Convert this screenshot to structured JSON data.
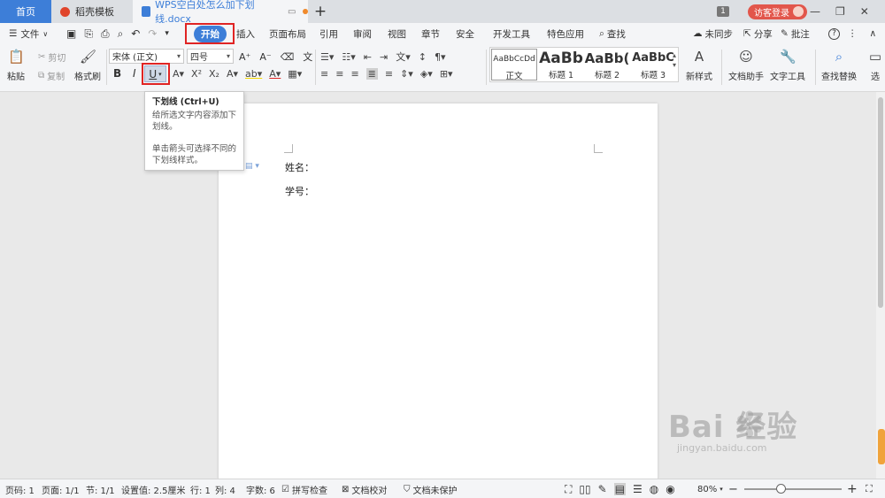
{
  "tabs": {
    "home": "首页",
    "template": "稻壳模板",
    "document": "WPS空白处怎么加下划线.docx",
    "new_tab": "+"
  },
  "titlebar": {
    "badge": "1",
    "login": "访客登录"
  },
  "menu": {
    "file": "文件",
    "items": [
      "开始",
      "插入",
      "页面布局",
      "引用",
      "审阅",
      "视图",
      "章节",
      "安全",
      "开发工具",
      "特色应用"
    ],
    "search": "查找",
    "sync": "未同步",
    "share": "分享",
    "comment": "批注",
    "help": "?"
  },
  "ribbon": {
    "paste": "粘贴",
    "cut": "剪切",
    "copy": "复制",
    "format_painter": "格式刷",
    "font_name": "宋体 (正文)",
    "font_size": "四号",
    "bold": "B",
    "italic": "I",
    "underline": "U",
    "styles": [
      {
        "preview": "AaBbCcDd",
        "label": "正文"
      },
      {
        "preview": "AaBb",
        "label": "标题 1"
      },
      {
        "preview": "AaBb(",
        "label": "标题 2"
      },
      {
        "preview": "AaBbC",
        "label": "标题 3"
      }
    ],
    "new_style": "新样式",
    "doc_assistant": "文档助手",
    "text_tools": "文字工具",
    "find_replace": "查找替换",
    "select": "选"
  },
  "tooltip": {
    "title": "下划线 (Ctrl+U)",
    "line1": "给所选文字内容添加下划线。",
    "line2": "单击箭头可选择不同的下划线样式。"
  },
  "document": {
    "line1": "姓名：",
    "line2": "学号："
  },
  "statusbar": {
    "page_num": "页码: 1",
    "pages": "页面: 1/1",
    "section": "节: 1/1",
    "setting": "设置值: 2.5厘米",
    "row": "行: 1",
    "col": "列: 4",
    "word_count": "字数: 6",
    "spell_check": "拼写检查",
    "proofread": "文档校对",
    "protect": "文档未保护",
    "zoom": "80%",
    "minus": "−",
    "plus": "+"
  },
  "watermark": {
    "main": "Bai  经验",
    "sub": "jingyan.baidu.com"
  },
  "colors": {
    "accent": "#3d7ed8",
    "highlight_box": "#e02424",
    "login": "#e2564b"
  }
}
